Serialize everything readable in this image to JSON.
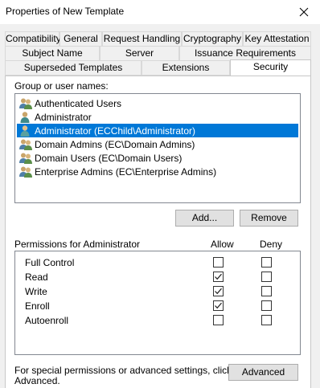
{
  "window": {
    "title": "Properties of New Template"
  },
  "tabs": {
    "row1": [
      "Compatibility",
      "General",
      "Request Handling",
      "Cryptography",
      "Key Attestation"
    ],
    "row2": [
      "Subject Name",
      "Server",
      "Issuance Requirements"
    ],
    "row3": [
      "Superseded Templates",
      "Extensions",
      "Security"
    ],
    "active": "Security"
  },
  "security": {
    "group_label": "Group or user names:",
    "users": [
      {
        "name": "Authenticated Users",
        "icon": "group-icon"
      },
      {
        "name": "Administrator",
        "icon": "user-icon"
      },
      {
        "name": "Administrator (ECChild\\Administrator)",
        "icon": "user-icon",
        "selected": true
      },
      {
        "name": "Domain Admins (EC\\Domain Admins)",
        "icon": "group-icon"
      },
      {
        "name": "Domain Users (EC\\Domain Users)",
        "icon": "group-icon"
      },
      {
        "name": "Enterprise Admins (EC\\Enterprise Admins)",
        "icon": "group-icon"
      }
    ],
    "add_label": "Add...",
    "remove_label": "Remove",
    "permissions_label": "Permissions for Administrator",
    "allow_label": "Allow",
    "deny_label": "Deny",
    "permissions": [
      {
        "name": "Full Control",
        "allow": false,
        "deny": false
      },
      {
        "name": "Read",
        "allow": true,
        "deny": false
      },
      {
        "name": "Write",
        "allow": true,
        "deny": false
      },
      {
        "name": "Enroll",
        "allow": true,
        "deny": false
      },
      {
        "name": "Autoenroll",
        "allow": false,
        "deny": false
      }
    ],
    "special_text_line1": "For special permissions or advanced settings, click",
    "special_text_line2": "Advanced.",
    "advanced_label": "Advanced"
  },
  "colors": {
    "selection": "#0078d7",
    "window_bg": "#f0f0f0"
  }
}
